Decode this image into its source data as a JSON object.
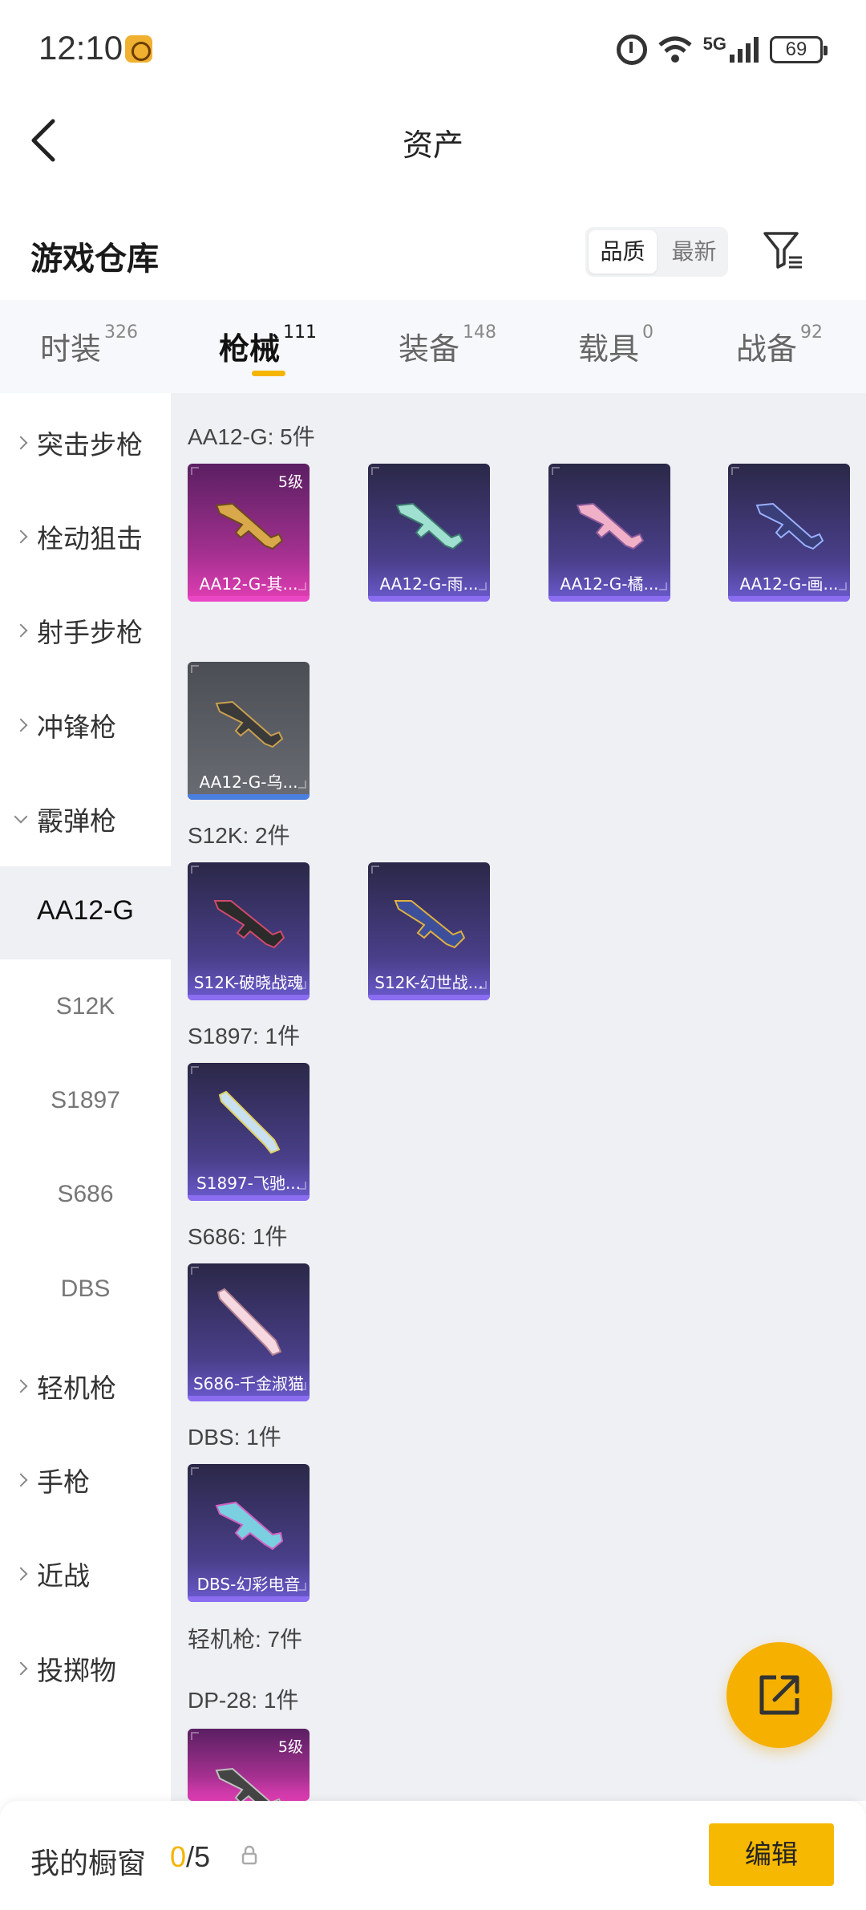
{
  "status_bar": {
    "time": "12:10",
    "network": "5G",
    "battery": "69"
  },
  "header": {
    "title": "资产"
  },
  "warehouse": {
    "title": "游戏仓库",
    "sort_options": [
      "品质",
      "最新"
    ]
  },
  "tabs": [
    {
      "label": "时装",
      "count": "326"
    },
    {
      "label": "枪械",
      "count": "111"
    },
    {
      "label": "装备",
      "count": "148"
    },
    {
      "label": "载具",
      "count": "0"
    },
    {
      "label": "战备",
      "count": "92"
    }
  ],
  "sidebar": {
    "categories": [
      "突击步枪",
      "栓动狙击",
      "射手步枪",
      "冲锋枪",
      "霰弹枪"
    ],
    "subitems": [
      "AA12-G",
      "S12K",
      "S1897",
      "S686",
      "DBS"
    ],
    "categories_after": [
      "轻机枪",
      "手枪",
      "近战",
      "投掷物"
    ]
  },
  "groups": {
    "aa12g": {
      "label": "AA12-G: 5件",
      "items": [
        {
          "name": "AA12-G-其...",
          "level": "5级",
          "rarity": "purple"
        },
        {
          "name": "AA12-G-雨...",
          "rarity": "blue"
        },
        {
          "name": "AA12-G-橘...",
          "rarity": "blue"
        },
        {
          "name": "AA12-G-画...",
          "rarity": "blue"
        },
        {
          "name": "AA12-G-乌...",
          "rarity": "gray"
        }
      ]
    },
    "s12k": {
      "label": "S12K: 2件",
      "items": [
        {
          "name": "S12K-破晓战魂"
        },
        {
          "name": "S12K-幻世战..."
        }
      ]
    },
    "s1897": {
      "label": "S1897: 1件",
      "items": [
        {
          "name": "S1897-飞驰..."
        }
      ]
    },
    "s686": {
      "label": "S686: 1件",
      "items": [
        {
          "name": "S686-千金淑猫"
        }
      ]
    },
    "dbs": {
      "label": "DBS: 1件",
      "items": [
        {
          "name": "DBS-幻彩电音"
        }
      ]
    },
    "lmg": {
      "label": "轻机枪: 7件"
    },
    "dp28": {
      "label": "DP-28: 1件",
      "items": [
        {
          "level": "5级"
        }
      ]
    }
  },
  "bottom": {
    "window_label": "我的橱窗",
    "current": "0",
    "sep_total": "/5",
    "edit_label": "编辑"
  },
  "colors": {
    "accent": "#f5b400",
    "rarity_purple": "#e33eb5",
    "rarity_blue": "#6b5bd0",
    "rarity_gray": "#6a6c73"
  },
  "icons": [
    "back-icon",
    "filter-icon",
    "share-icon",
    "lock-icon",
    "alarm-icon",
    "wifi-icon",
    "signal-icon",
    "battery-icon"
  ]
}
